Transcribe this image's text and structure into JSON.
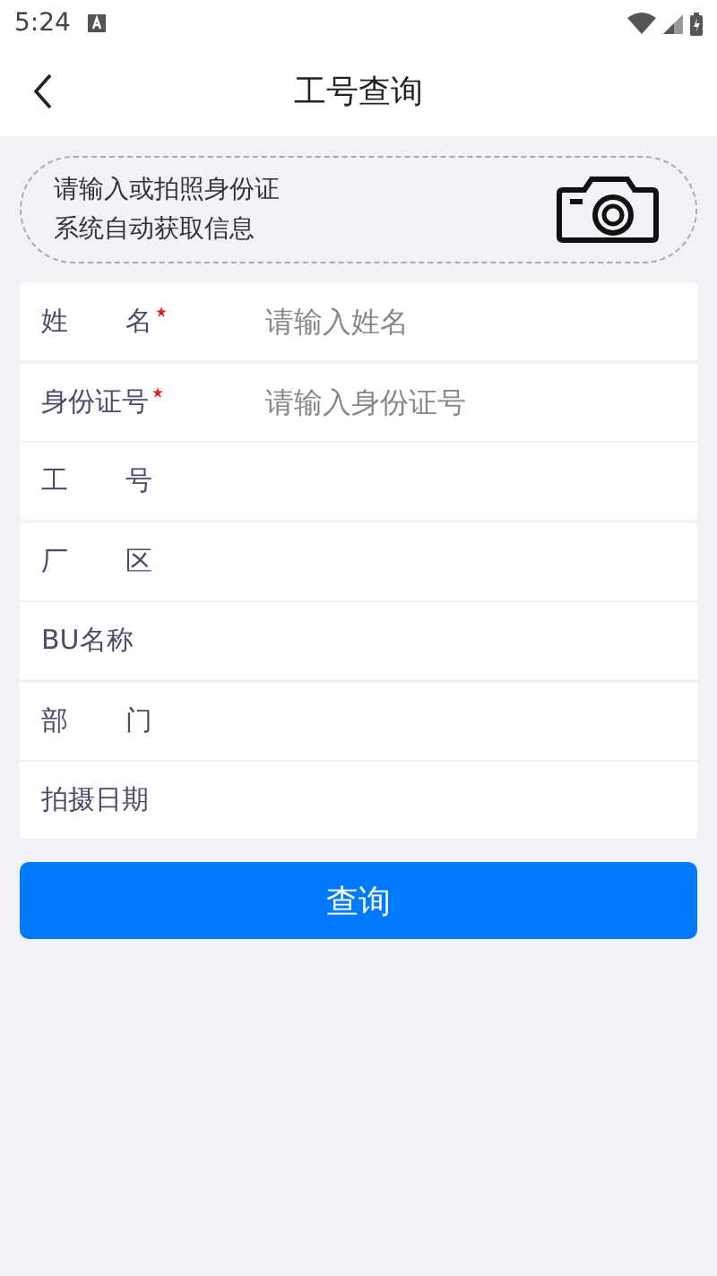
{
  "status_bar": {
    "time": "5:24"
  },
  "header": {
    "title": "工号查询"
  },
  "scan_card": {
    "lines": [
      "请输入或拍照身份证",
      "系统自动获取信息"
    ]
  },
  "form": {
    "rows": [
      {
        "label": "姓名",
        "required": true,
        "kind": "input",
        "placeholder": "请输入姓名"
      },
      {
        "label": "身份证号",
        "required": true,
        "kind": "input",
        "placeholder": "请输入身份证号"
      },
      {
        "label": "工号",
        "required": false,
        "kind": "text"
      },
      {
        "label": "厂区",
        "required": false,
        "kind": "text"
      },
      {
        "label": "BU名称",
        "required": false,
        "kind": "text"
      },
      {
        "label": "部门",
        "required": false,
        "kind": "text"
      },
      {
        "label": "拍摄日期",
        "required": false,
        "kind": "text"
      }
    ]
  },
  "submit_button": {
    "label": "查询"
  }
}
